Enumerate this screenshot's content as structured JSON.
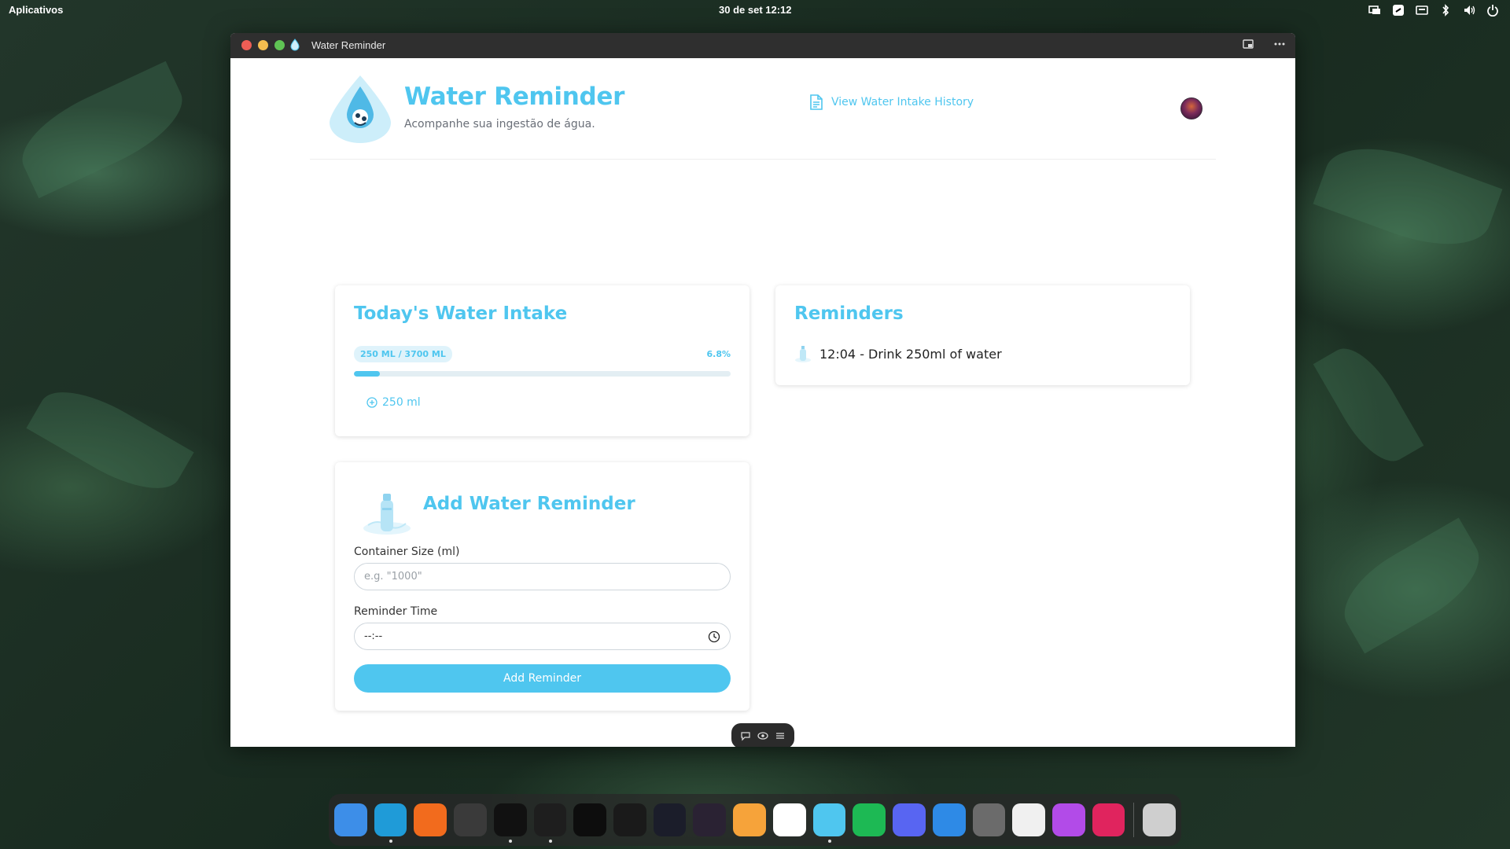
{
  "topbar": {
    "apps_label": "Aplicativos",
    "clock": "30 de set  12:12",
    "tray_icons": [
      "display-icon",
      "sync-icon",
      "keyboard-icon",
      "bluetooth-icon",
      "volume-icon",
      "power-icon"
    ]
  },
  "window": {
    "title": "Water Reminder"
  },
  "header": {
    "title": "Water Reminder",
    "subtitle": "Acompanhe sua ingestão de água.",
    "history_link": "View Water Intake History"
  },
  "intake": {
    "title": "Today's Water Intake",
    "badge": "250 ML / 3700 ML",
    "percent": "6.8%",
    "progress_fraction": 0.068,
    "add_amount": "250 ml"
  },
  "reminders": {
    "title": "Reminders",
    "items": [
      {
        "text": "12:04 - Drink 250ml of water"
      }
    ]
  },
  "add_reminder": {
    "title": "Add Water Reminder",
    "size_label": "Container Size (ml)",
    "size_placeholder": "e.g. \"1000\"",
    "time_label": "Reminder Time",
    "time_value": "--:--",
    "button": "Add Reminder"
  },
  "colors": {
    "accent": "#4fc6ef",
    "badge_bg": "#dff3fb",
    "titlebar": "#2f2f2f"
  },
  "dock": {
    "items": [
      {
        "name": "files-icon",
        "color": "#3d8ee8",
        "running": false
      },
      {
        "name": "edge-browser-icon",
        "color": "#1f9bd8",
        "running": true
      },
      {
        "name": "firefox-icon",
        "color": "#f26b1d",
        "running": false
      },
      {
        "name": "terminal-icon",
        "color": "#3a3a3a",
        "running": false
      },
      {
        "name": "code-editor-icon",
        "color": "#111",
        "running": true
      },
      {
        "name": "vscode-icon",
        "color": "#1e1e1e",
        "running": true
      },
      {
        "name": "pycharm-icon",
        "color": "#0d0d0d",
        "running": false
      },
      {
        "name": "text-editor-icon",
        "color": "#1a1a1a",
        "running": false
      },
      {
        "name": "linear-icon",
        "color": "#1b1d2a",
        "running": false
      },
      {
        "name": "obsidian-icon",
        "color": "#2a2233",
        "running": false
      },
      {
        "name": "pen-app-icon",
        "color": "#f6a33a",
        "running": false
      },
      {
        "name": "slack-icon",
        "color": "#ffffff",
        "running": false
      },
      {
        "name": "water-reminder-icon",
        "color": "#4fc6ef",
        "running": true
      },
      {
        "name": "spotify-icon",
        "color": "#1db954",
        "running": false
      },
      {
        "name": "discord-icon",
        "color": "#5865f2",
        "running": false
      },
      {
        "name": "software-store-icon",
        "color": "#2e8ae6",
        "running": false
      },
      {
        "name": "settings-icon",
        "color": "#6b6b6b",
        "running": false
      },
      {
        "name": "mail-icon",
        "color": "#f0f0f0",
        "running": false
      },
      {
        "name": "sphere-app-icon",
        "color": "#b24be8",
        "running": false
      },
      {
        "name": "vpn-icon",
        "color": "#e0245e",
        "running": false
      },
      {
        "name": "disk-utility-icon",
        "color": "#cfcfcf",
        "running": false
      }
    ]
  }
}
